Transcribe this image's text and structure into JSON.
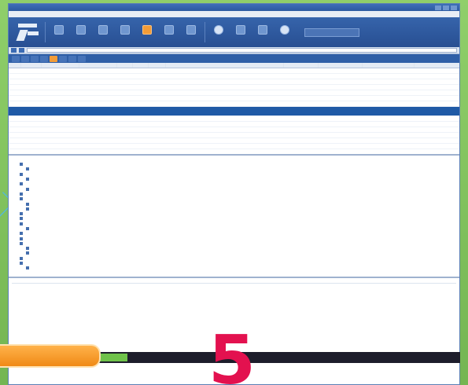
{
  "window": {
    "title": ""
  },
  "menubar": {
    "items": [
      "",
      "",
      "",
      ""
    ]
  },
  "toolbar": {
    "buttons": [
      {
        "label": "",
        "icon": "remove-icon"
      },
      {
        "label": "",
        "icon": "go-icon"
      },
      {
        "label": "",
        "icon": "stream-icon"
      },
      {
        "label": "",
        "icon": "decode-icon"
      },
      {
        "label": "",
        "icon": "keep-icon"
      },
      {
        "label": "",
        "icon": "find-icon"
      },
      {
        "label": "",
        "icon": "save-icon"
      },
      {
        "label": "",
        "icon": "browse-icon"
      },
      {
        "label": "",
        "icon": "clear-icon"
      },
      {
        "label": "",
        "icon": "tools-icon"
      },
      {
        "label": "",
        "icon": "online-icon"
      }
    ],
    "search_placeholder": ""
  },
  "urlbar": {
    "address": ""
  },
  "filter_tabs": [
    {
      "label": "",
      "active": false
    },
    {
      "label": "",
      "active": false
    },
    {
      "label": "",
      "active": false
    },
    {
      "label": "",
      "active": false
    },
    {
      "label": "",
      "active": true
    },
    {
      "label": "",
      "active": false
    },
    {
      "label": "",
      "active": false
    },
    {
      "label": "",
      "active": false
    }
  ],
  "sessions": {
    "columns": [
      "",
      "",
      "",
      "",
      "",
      "",
      "",
      "",
      "",
      "",
      ""
    ],
    "rows": [
      [
        "",
        "",
        "",
        "",
        "",
        "",
        "",
        "",
        "",
        "",
        ""
      ],
      [
        "",
        "",
        "",
        "",
        "",
        "",
        "",
        "",
        "",
        "",
        ""
      ],
      [
        "",
        "",
        "",
        "",
        "",
        "",
        "",
        "",
        "",
        "",
        ""
      ],
      [
        "",
        "",
        "",
        "",
        "",
        "",
        "",
        "",
        "",
        "",
        ""
      ],
      [
        "",
        "",
        "",
        "",
        "",
        "",
        "",
        "",
        "",
        "",
        ""
      ],
      [
        "",
        "",
        "",
        "",
        "",
        "",
        "",
        "",
        "",
        "",
        ""
      ],
      [
        "",
        "",
        "",
        "",
        "",
        "",
        "",
        "",
        "",
        "",
        ""
      ],
      [
        "",
        "",
        "",
        "",
        "",
        "",
        "",
        "",
        "",
        "",
        ""
      ],
      [
        "",
        "",
        "",
        "",
        "",
        "",
        "",
        "",
        "",
        "",
        ""
      ],
      [
        "",
        "",
        "",
        "",
        "",
        "",
        "",
        "",
        "",
        "",
        ""
      ],
      [
        "",
        "",
        "",
        "",
        "",
        "",
        "",
        "",
        "",
        "",
        ""
      ],
      [
        "",
        "",
        "",
        "",
        "",
        "",
        "",
        "",
        "",
        "",
        ""
      ],
      [
        "",
        "",
        "",
        "",
        "",
        "",
        "",
        "",
        "",
        "",
        ""
      ],
      [
        "",
        "",
        "",
        "",
        "",
        "",
        "",
        "",
        "",
        "",
        ""
      ]
    ],
    "selected_row": 7
  },
  "inspector": {
    "header": "",
    "nodes": [
      "",
      "",
      "",
      "",
      "",
      "",
      "",
      "",
      "",
      "",
      "",
      "",
      "",
      "",
      "",
      "",
      "",
      "",
      "",
      "",
      "",
      ""
    ]
  },
  "hexview": {
    "header": [
      "",
      "",
      "",
      "",
      "",
      "",
      "",
      "",
      "",
      "",
      "",
      "",
      "",
      "",
      "",
      "",
      "",
      ""
    ],
    "rows": [
      {
        "offset": "",
        "bytes": [
          "",
          "",
          "",
          "",
          "",
          "",
          "",
          "",
          "",
          "",
          "",
          "",
          "",
          "",
          "",
          ""
        ],
        "ascii": ""
      },
      {
        "offset": "",
        "bytes": [
          "",
          "",
          "",
          "",
          "",
          "",
          "",
          "",
          "",
          "",
          "",
          "",
          "",
          "",
          "",
          ""
        ],
        "ascii": ""
      },
      {
        "offset": "",
        "bytes": [
          "",
          "",
          "",
          "",
          "",
          "",
          "",
          "",
          "",
          "",
          "",
          "",
          "",
          "",
          "",
          ""
        ],
        "ascii": ""
      },
      {
        "offset": "",
        "bytes": [
          "",
          "",
          "",
          "",
          "",
          "",
          "",
          "",
          "",
          "",
          "",
          "",
          "",
          "",
          "",
          ""
        ],
        "ascii": ""
      },
      {
        "offset": "",
        "bytes": [
          "",
          "",
          "",
          "",
          "",
          "",
          "",
          "",
          "",
          "",
          "",
          "",
          "",
          "",
          "",
          ""
        ],
        "ascii": ""
      },
      {
        "offset": "",
        "bytes": [
          "",
          "",
          "",
          "",
          "",
          "",
          "",
          "",
          "",
          "",
          "",
          "",
          "",
          "",
          "",
          ""
        ],
        "ascii": ""
      },
      {
        "offset": "",
        "bytes": [
          "",
          "",
          "",
          "",
          "",
          "",
          "",
          "",
          "",
          "",
          "",
          "",
          "",
          "",
          "",
          ""
        ],
        "ascii": ""
      },
      {
        "offset": "",
        "bytes": [
          "",
          "",
          "",
          "",
          "",
          "",
          "",
          "",
          "",
          "",
          "",
          "",
          "",
          "",
          "",
          ""
        ],
        "ascii": ""
      },
      {
        "offset": "",
        "bytes": [
          "",
          "",
          "",
          "",
          "",
          "",
          "",
          "",
          "",
          "",
          "",
          "",
          "",
          "",
          "",
          ""
        ],
        "ascii": ""
      },
      {
        "offset": "",
        "bytes": [
          "",
          "",
          "",
          "",
          "",
          "",
          "",
          "",
          "",
          "",
          "",
          "",
          "",
          "",
          "",
          ""
        ],
        "ascii": ""
      },
      {
        "offset": "",
        "bytes": [
          "",
          "",
          "",
          "",
          "",
          "",
          "",
          "",
          "",
          "",
          "",
          "",
          "",
          "",
          "",
          ""
        ],
        "ascii": ""
      },
      {
        "offset": "",
        "bytes": [
          "",
          "",
          "",
          "",
          "",
          "",
          "",
          "",
          "",
          "",
          "",
          "",
          "",
          "",
          "",
          ""
        ],
        "ascii": ""
      },
      {
        "offset": "",
        "bytes": [
          "",
          "",
          "",
          "",
          "",
          "",
          "",
          "",
          "",
          "",
          "",
          "",
          "",
          "",
          "",
          ""
        ],
        "ascii": ""
      },
      {
        "offset": "",
        "bytes": [
          "",
          "",
          "",
          "",
          "",
          "",
          "",
          "",
          "",
          "",
          "",
          "",
          "",
          "",
          "",
          ""
        ],
        "ascii": ""
      }
    ]
  },
  "statusbar": {
    "left": "",
    "middle": ""
  },
  "overlay": {
    "step_number": "5"
  },
  "colors": {
    "toolbar_blue": "#2c5aa0",
    "selection_blue": "#1f5aa6",
    "accent_orange": "#f29c38",
    "step_magenta": "#e3114f",
    "desktop_green": "#7fbf5a"
  }
}
